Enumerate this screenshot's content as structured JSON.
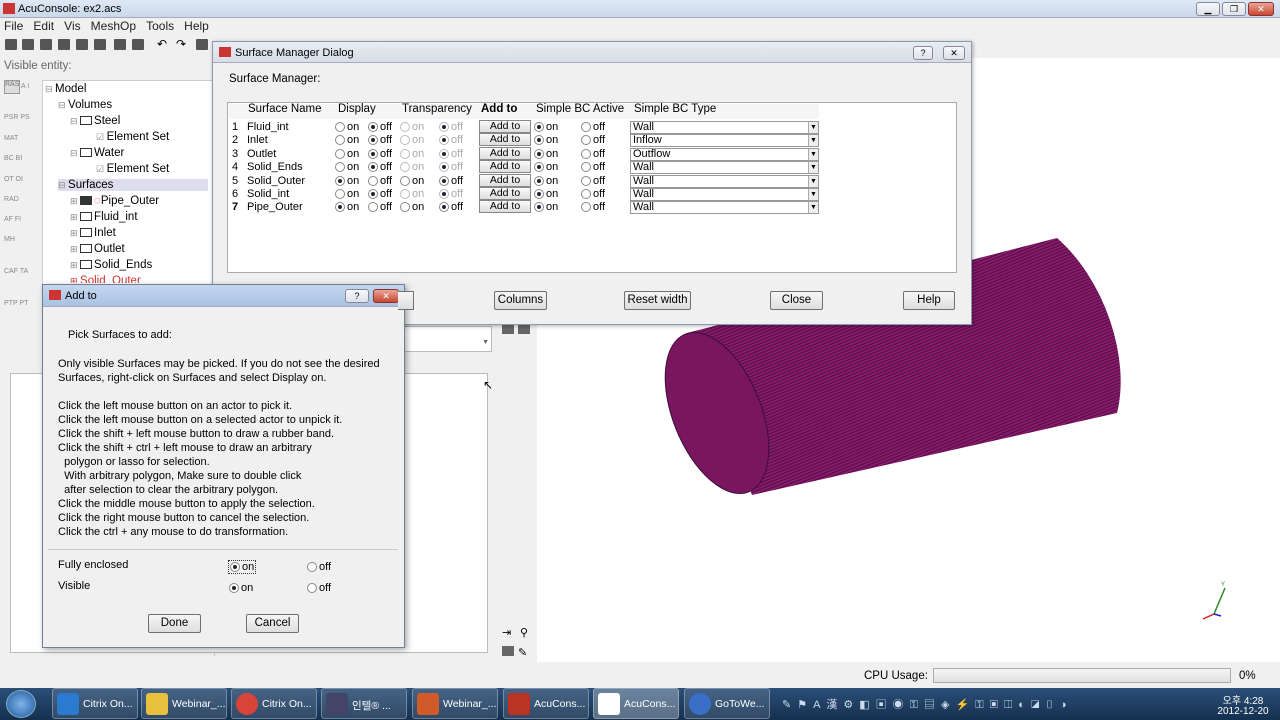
{
  "app": {
    "title": "AcuConsole:   ex2.acs",
    "menu": [
      "File",
      "Edit",
      "Vis",
      "MeshOp",
      "Tools",
      "Help"
    ],
    "visible_entity_label": "Visible entity:",
    "side_tags": [
      "PSR PS",
      "MAT",
      "BC BI",
      "OT OI",
      "RAD",
      "AF FI",
      "MH",
      "CAF TA",
      "PTP PT"
    ]
  },
  "tree": {
    "model": "Model",
    "volumes": "Volumes",
    "steel": "Steel",
    "element_set_1": "Element Set",
    "water": "Water",
    "element_set_2": "Element Set",
    "surfaces": "Surfaces",
    "pipe_outer": "Pipe_Outer",
    "fluid_int": "Fluid_int",
    "inlet": "Inlet",
    "outlet": "Outlet",
    "solid_ends": "Solid_Ends",
    "solid_outer": "Solid_Outer"
  },
  "surface_dialog": {
    "title": "Surface Manager Dialog",
    "heading": "Surface Manager:",
    "columns": [
      "Surface Name",
      "Display",
      "Transparency",
      "Add to",
      "Simple BC Active",
      "Simple BC Type"
    ],
    "on": "on",
    "off": "off",
    "add_to": "Add to",
    "rows": [
      {
        "num": "1",
        "name": "Fluid_int",
        "display_on": false,
        "trans_on": false,
        "bc_active_on": true,
        "bc_type": "Wall",
        "trans_enabled": false
      },
      {
        "num": "2",
        "name": "Inlet",
        "display_on": false,
        "trans_on": false,
        "bc_active_on": true,
        "bc_type": "Inflow",
        "trans_enabled": false
      },
      {
        "num": "3",
        "name": "Outlet",
        "display_on": false,
        "trans_on": false,
        "bc_active_on": true,
        "bc_type": "Outflow",
        "trans_enabled": false
      },
      {
        "num": "4",
        "name": "Solid_Ends",
        "display_on": false,
        "trans_on": false,
        "bc_active_on": true,
        "bc_type": "Wall",
        "trans_enabled": false
      },
      {
        "num": "5",
        "name": "Solid_Outer",
        "display_on": true,
        "trans_on": false,
        "bc_active_on": true,
        "bc_type": "Wall",
        "trans_enabled": true
      },
      {
        "num": "6",
        "name": "Solid_int",
        "display_on": false,
        "trans_on": false,
        "bc_active_on": true,
        "bc_type": "Wall",
        "trans_enabled": false
      },
      {
        "num": "7",
        "name": "Pipe_Outer",
        "display_on": true,
        "trans_on": false,
        "bc_active_on": true,
        "bc_type": "Wall",
        "trans_enabled": true
      }
    ],
    "buttons": {
      "columns": "Columns",
      "reset_width": "Reset width",
      "close": "Close",
      "help": "Help"
    }
  },
  "add_to_dialog": {
    "title": "Add to",
    "pick_label": "Pick Surfaces to add:",
    "note": "Only visible Surfaces may be picked. If you do not see the desired\nSurfaces, right-click on Surfaces and select Display on.",
    "instructions": "Click the left mouse button on an actor to pick it.\nClick the left mouse button on a selected actor to unpick it.\nClick the shift + left mouse button to draw a rubber band.\nClick the shift + ctrl + left mouse to draw an arbitrary\n  polygon or lasso for selection.\n  With arbitrary polygon, Make sure to double click\n  after selection to clear the arbitrary polygon.\nClick the middle mouse button to apply the selection.\nClick the right mouse button to cancel the selection.\nClick the ctrl + any mouse to do transformation.",
    "fully_enclosed": "Fully enclosed",
    "visible": "Visible",
    "on": "on",
    "off": "off",
    "done": "Done",
    "cancel": "Cancel"
  },
  "status": {
    "cpu_label": "CPU Usage:",
    "cpu_value": "0%",
    "cpu_fraction": 0
  },
  "taskbar": {
    "items": [
      "Citrix On...",
      "Webinar_...",
      "Citrix On...",
      "인텔® ...",
      "Webinar_...",
      "AcuCons...",
      "AcuCons...",
      "GoToWe..."
    ],
    "time": "오후 4:28",
    "date": "2012-12-20"
  },
  "colors": {
    "cylinder": "#8b1a6b",
    "cylinder_dark": "#3a0d3a",
    "taskbar": "#1c3a5e"
  }
}
